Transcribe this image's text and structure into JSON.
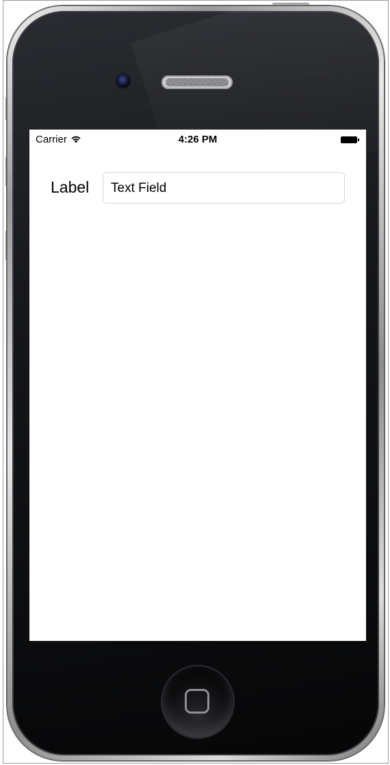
{
  "status_bar": {
    "carrier": "Carrier",
    "wifi_icon": "wifi-icon",
    "time": "4:26 PM",
    "battery_icon": "battery-full-icon"
  },
  "form": {
    "label": "Label",
    "text_field_value": "Text Field"
  },
  "device": {
    "camera_icon": "camera-icon",
    "speaker_icon": "speaker-icon",
    "home_button_icon": "home-square-icon"
  },
  "colors": {
    "screen_background": "#ffffff",
    "bezel": "#111215",
    "text_field_border": "#d6d6d6"
  }
}
